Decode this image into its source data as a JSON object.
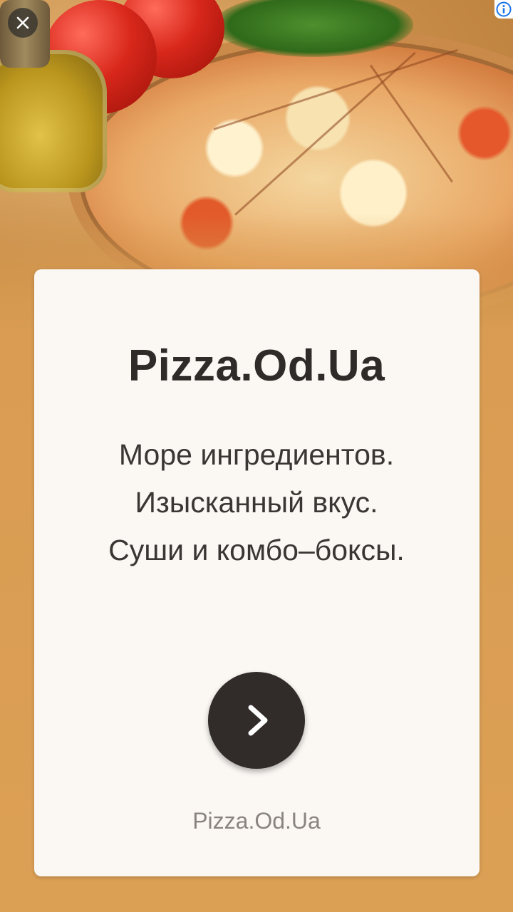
{
  "ad": {
    "title": "Pizza.Od.Ua",
    "tagline": [
      "Море ингредиентов.",
      "Изысканный вкус.",
      "Суши и комбо–боксы."
    ],
    "domain": "Pizza.Od.Ua",
    "cta_icon": "chevron-right-icon"
  },
  "controls": {
    "close_icon": "close-icon",
    "info_icon": "info-icon"
  },
  "colors": {
    "background": "#d99c52",
    "card": "#fbf8f3",
    "title": "#2e2b28",
    "cta_button": "#312c29",
    "info_accent": "#1a73e8"
  }
}
